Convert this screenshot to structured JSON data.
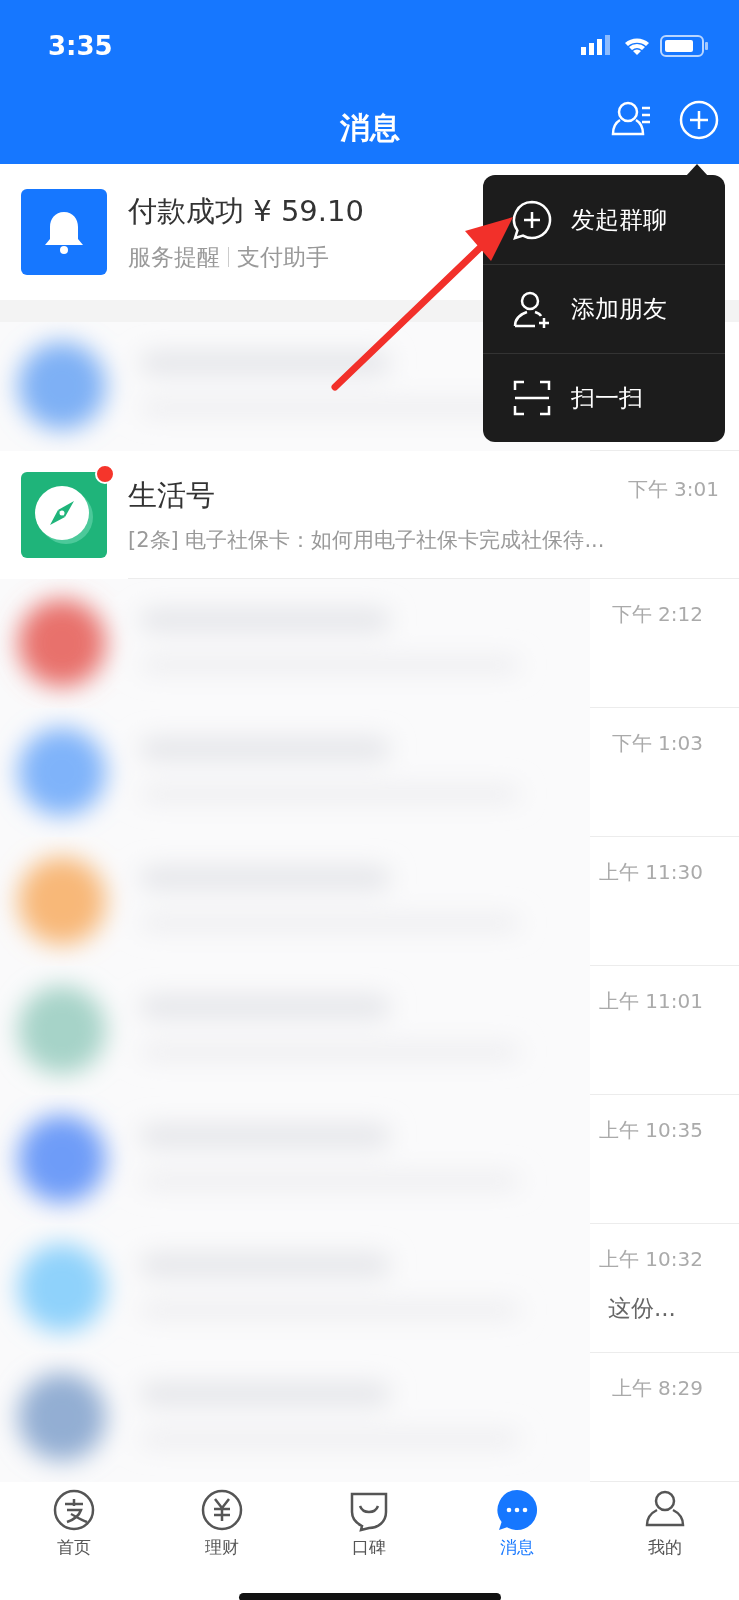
{
  "status_bar": {
    "time": "3:35"
  },
  "header": {
    "title": "消息"
  },
  "popup_menu": {
    "items": [
      {
        "kind": "group-chat",
        "label": "发起群聊"
      },
      {
        "kind": "add-friend",
        "label": "添加朋友"
      },
      {
        "kind": "scan",
        "label": "扫一扫"
      }
    ]
  },
  "messages": [
    {
      "kind": "service",
      "title": "付款成功 ¥ 59.10",
      "subtitle_parts": [
        "服务提醒",
        "支付助手"
      ]
    },
    {
      "kind": "blurred",
      "color": "#7eb0f5"
    },
    {
      "kind": "app",
      "title": "生活号",
      "time": "下午 3:01",
      "preview": "[2条] 电子社保卡：如何用电子社保卡完成社保待...",
      "unread": true
    },
    {
      "kind": "blurred",
      "color": "#e8716c",
      "time": "下午 2:12"
    },
    {
      "kind": "blurred",
      "color": "#7fb3fa",
      "time": "下午 1:03"
    },
    {
      "kind": "blurred",
      "color": "#f8b878",
      "time": "上午 11:30"
    },
    {
      "kind": "blurred",
      "color": "#a6d3c8",
      "time": "上午 11:01"
    },
    {
      "kind": "blurred",
      "color": "#6e9cf8",
      "time": "上午 10:35"
    },
    {
      "kind": "blurred",
      "color": "#8fd2fb",
      "time": "上午 10:32",
      "preview": "这份..."
    },
    {
      "kind": "blurred",
      "color": "#93aed3",
      "time": "上午 8:29"
    }
  ],
  "tab_bar": {
    "items": [
      {
        "kind": "home",
        "label": "首页",
        "selected": false
      },
      {
        "kind": "wealth",
        "label": "理财",
        "selected": false
      },
      {
        "kind": "koubei",
        "label": "口碑",
        "selected": false
      },
      {
        "kind": "messages",
        "label": "消息",
        "selected": true
      },
      {
        "kind": "me",
        "label": "我的",
        "selected": false
      }
    ]
  }
}
